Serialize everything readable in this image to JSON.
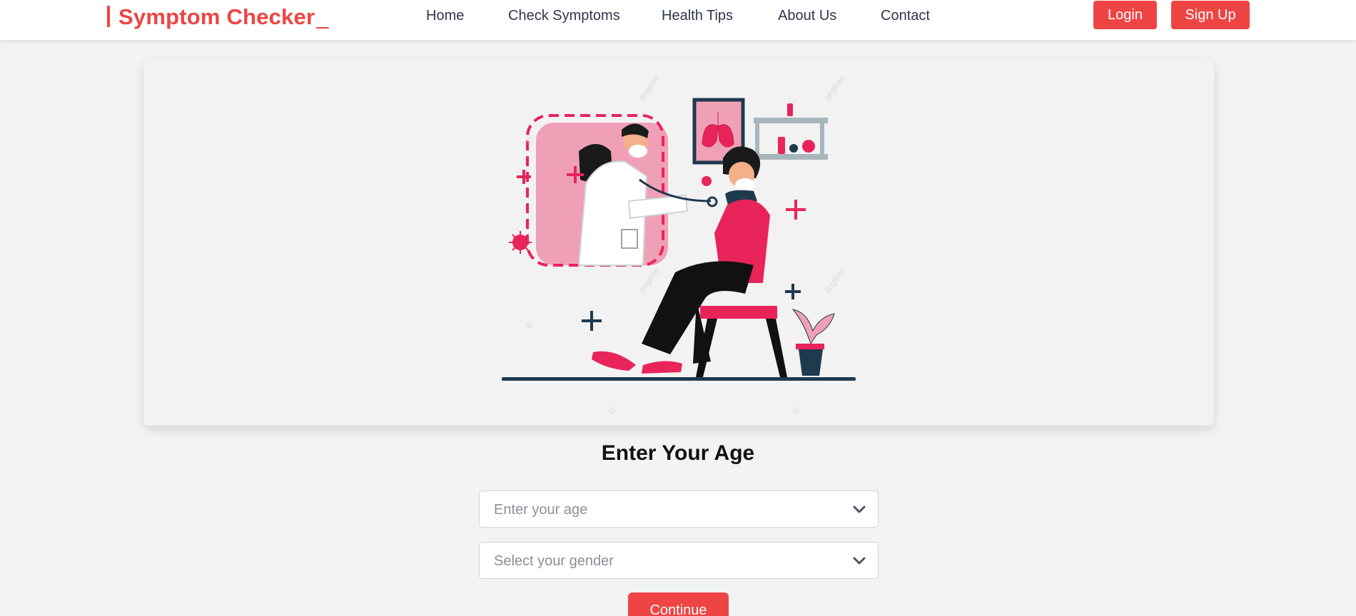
{
  "header": {
    "brand": "Symptom Checker",
    "brand_cursor": "_",
    "nav": [
      "Home",
      "Check Symptoms",
      "Health Tips",
      "About Us",
      "Contact"
    ],
    "login_label": "Login",
    "signup_label": "Sign Up"
  },
  "hero": {
    "illustration": "doctor-examining-patient-illustration",
    "watermark_text": "pngtree"
  },
  "form": {
    "title": "Enter Your Age",
    "age_placeholder": "Enter your age",
    "gender_placeholder": "Select your gender",
    "continue_label": "Continue"
  },
  "colors": {
    "accent": "#ef4444",
    "pink": "#e8245a",
    "navy": "#1e3a4f",
    "background": "#f2f3f5"
  }
}
